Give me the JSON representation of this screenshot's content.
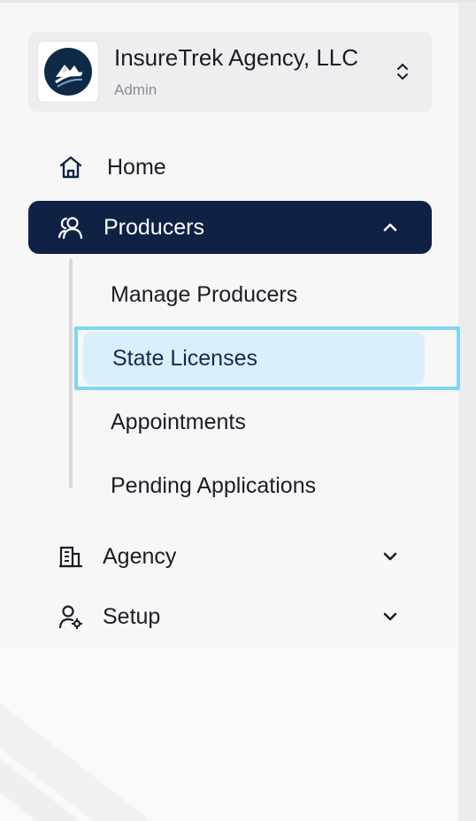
{
  "account": {
    "name": "InsureTrek Agency, LLC",
    "role": "Admin",
    "logo_icon": "insuretrek-logo",
    "switcher_icon": "chevron-up-down-icon"
  },
  "nav": {
    "home": {
      "label": "Home",
      "icon": "home-icon"
    },
    "producers": {
      "label": "Producers",
      "icon": "users-icon",
      "expanded": true,
      "items": [
        {
          "label": "Manage Producers"
        },
        {
          "label": "State Licenses",
          "selected": true
        },
        {
          "label": "Appointments"
        },
        {
          "label": "Pending Applications"
        }
      ]
    },
    "agency": {
      "label": "Agency",
      "icon": "building-icon",
      "expanded": false
    },
    "setup": {
      "label": "Setup",
      "icon": "user-gear-icon",
      "expanded": false
    }
  },
  "colors": {
    "active_nav_bg": "#0f2246",
    "selected_subitem_bg": "#dbeefb",
    "focus_ring": "#7ed6f3",
    "sidebar_bg": "#f7f7f8"
  }
}
